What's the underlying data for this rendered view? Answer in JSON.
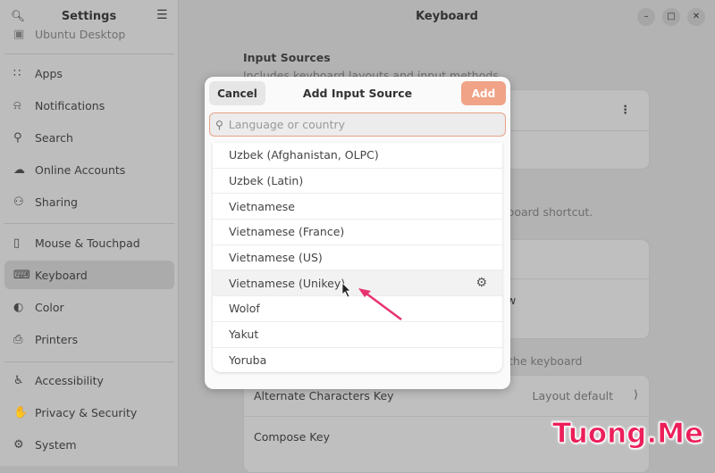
{
  "sidebar": {
    "title": "Settings",
    "partial_item": "Ubuntu Desktop",
    "items": [
      {
        "label": "Apps",
        "icon": "apps-grid-icon"
      },
      {
        "label": "Notifications",
        "icon": "bell-icon"
      },
      {
        "label": "Search",
        "icon": "search-icon"
      },
      {
        "label": "Online Accounts",
        "icon": "cloud-icon"
      },
      {
        "label": "Sharing",
        "icon": "share-icon"
      },
      {
        "label": "Mouse & Touchpad",
        "icon": "mouse-icon"
      },
      {
        "label": "Keyboard",
        "icon": "keyboard-icon",
        "selected": true
      },
      {
        "label": "Color",
        "icon": "color-icon"
      },
      {
        "label": "Printers",
        "icon": "printer-icon"
      },
      {
        "label": "Accessibility",
        "icon": "accessibility-icon"
      },
      {
        "label": "Privacy & Security",
        "icon": "hand-icon"
      },
      {
        "label": "System",
        "icon": "system-gear-icon"
      }
    ]
  },
  "main": {
    "title": "Keyboard",
    "input_sources_title": "Input Sources",
    "input_sources_desc": "Includes keyboard layouts and input methods.",
    "switch_desc_fragment": "yboard shortcut.",
    "row_fragment": "w",
    "special_desc_fragment": "the keyboard",
    "alt_key_label": "Alternate Characters Key",
    "alt_key_value": "Layout default",
    "compose_label": "Compose Key"
  },
  "dialog": {
    "title": "Add Input Source",
    "cancel": "Cancel",
    "add": "Add",
    "search_placeholder": "Language or country",
    "items": [
      "Uzbek (Afghanistan, OLPC)",
      "Uzbek (Latin)",
      "Vietnamese",
      "Vietnamese (France)",
      "Vietnamese (US)",
      "Vietnamese (Unikey)",
      "Wolof",
      "Yakut",
      "Yoruba"
    ],
    "hovered": "Vietnamese (Unikey)"
  },
  "watermark": "Tuong.Me",
  "colors": {
    "accent": "#f0a386",
    "annotation_arrow": "#e8336f"
  }
}
